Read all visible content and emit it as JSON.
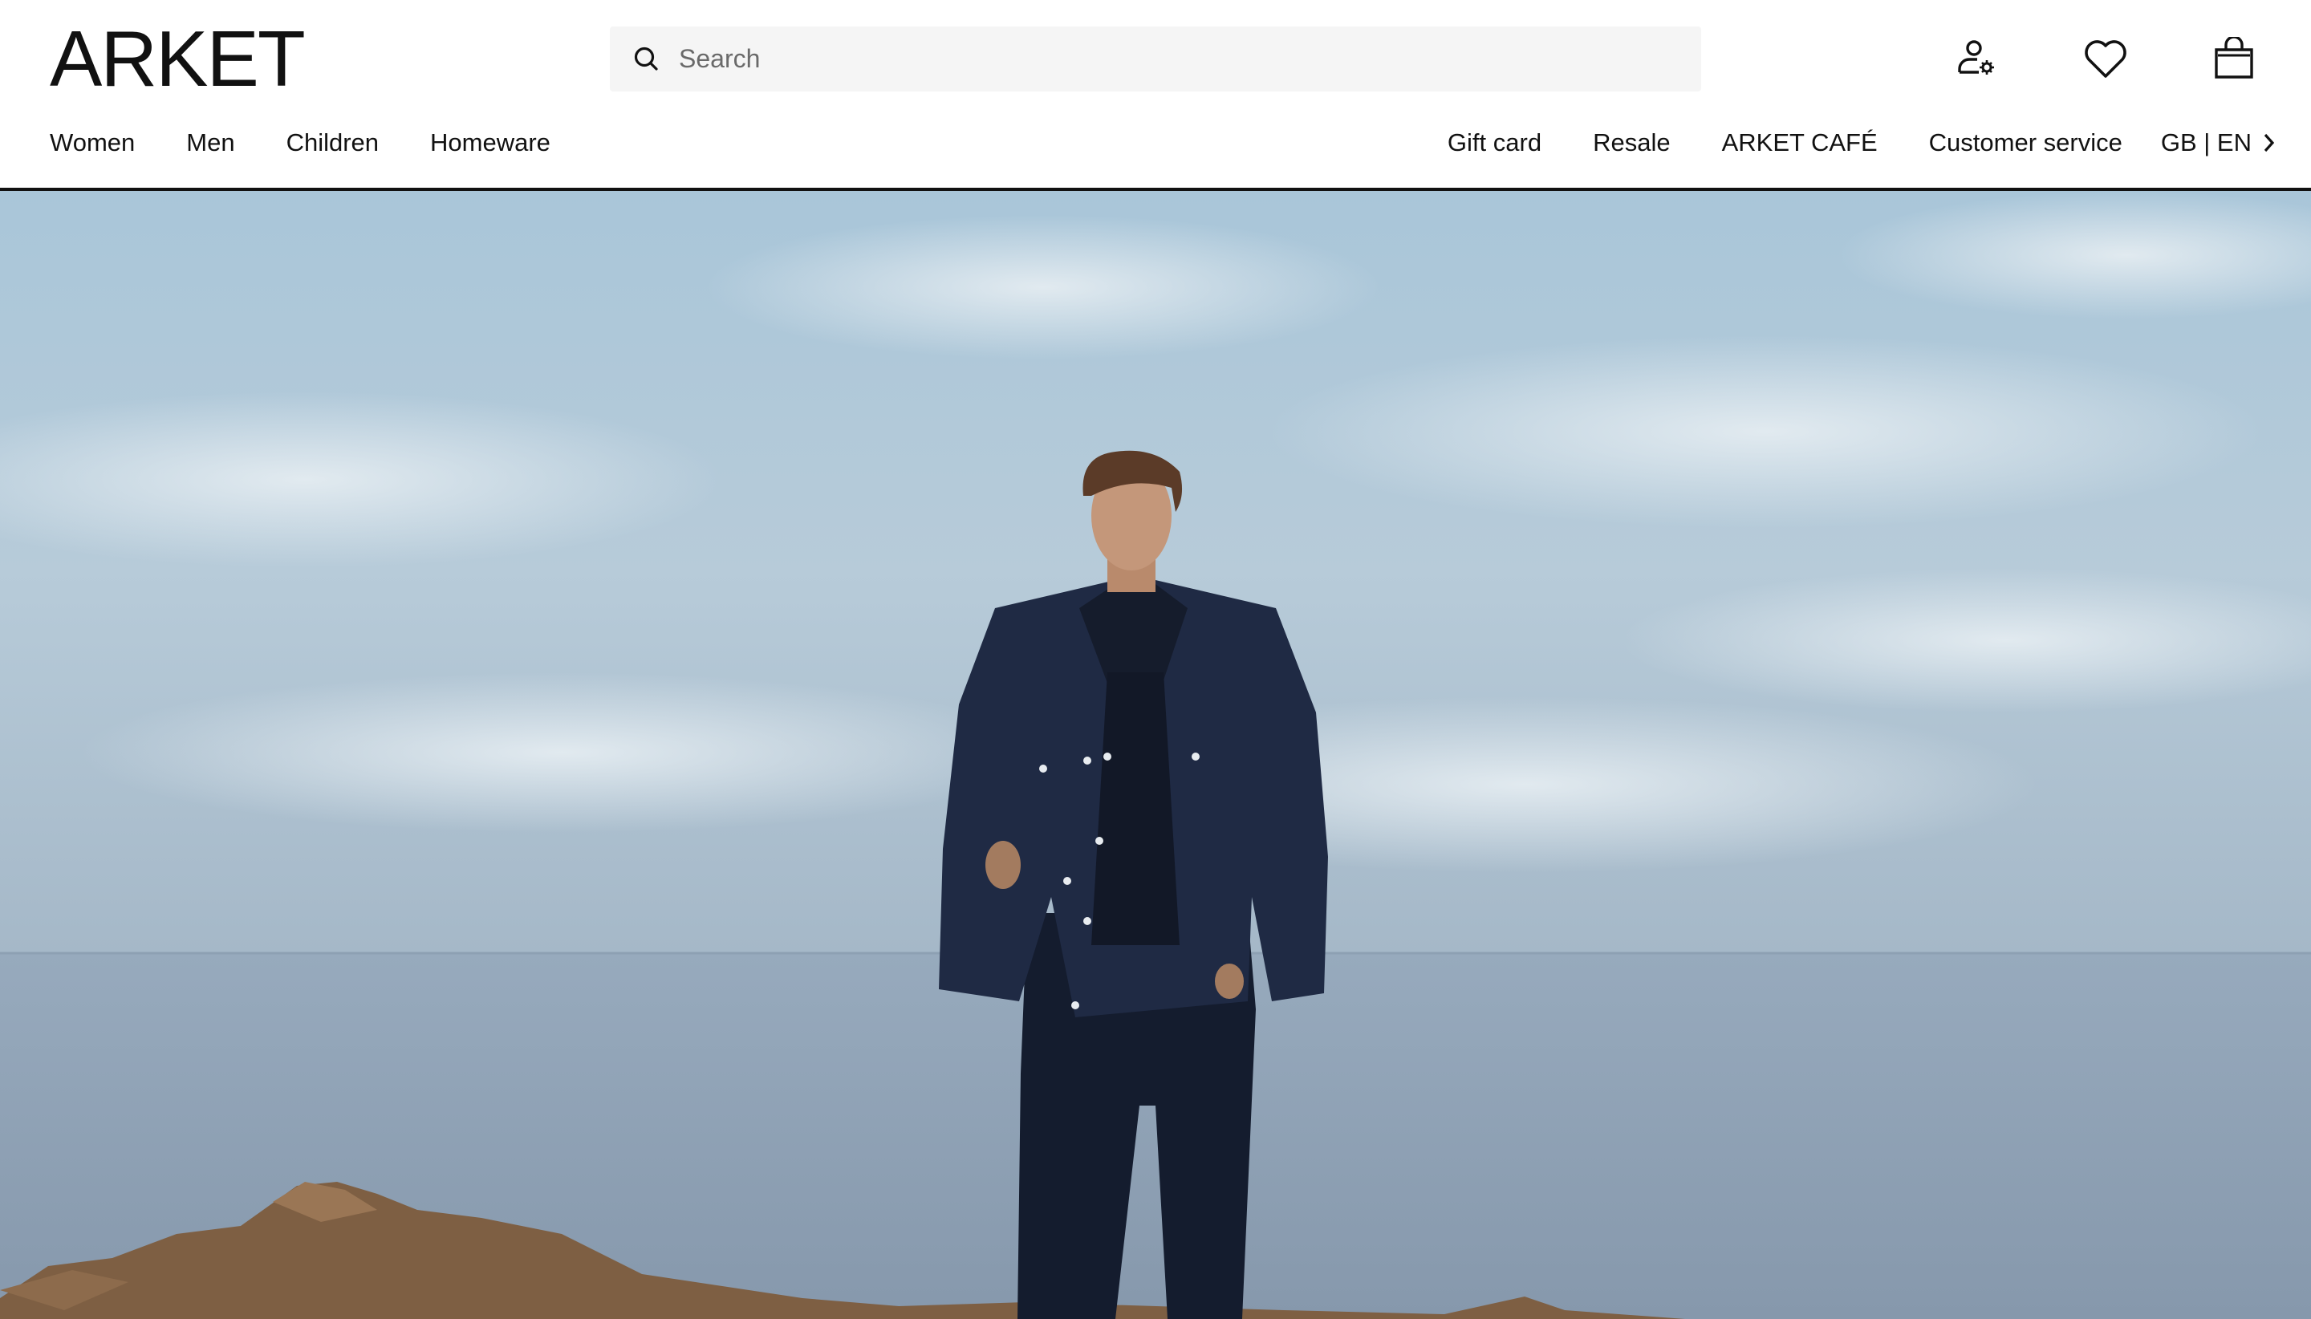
{
  "header": {
    "logo": "ARKET",
    "search": {
      "placeholder": "Search",
      "icon": "search-icon"
    },
    "icons": {
      "account": "account-icon",
      "wishlist": "heart-icon",
      "bag": "shopping-bag-icon"
    }
  },
  "nav": {
    "left": [
      {
        "label": "Women"
      },
      {
        "label": "Men"
      },
      {
        "label": "Children"
      },
      {
        "label": "Homeware"
      }
    ],
    "right": [
      {
        "label": "Gift card"
      },
      {
        "label": "Resale"
      },
      {
        "label": "ARKET CAFÉ"
      },
      {
        "label": "Customer service"
      }
    ],
    "locale": {
      "label": "GB | EN",
      "icon": "chevron-right-icon"
    }
  },
  "hero": {
    "image": "hero-campaign-image",
    "colors": {
      "sky": "#9db8cc",
      "sea": "#8ea2b6",
      "rock": "#7a5a3e",
      "jacket": "#1d2740"
    }
  }
}
